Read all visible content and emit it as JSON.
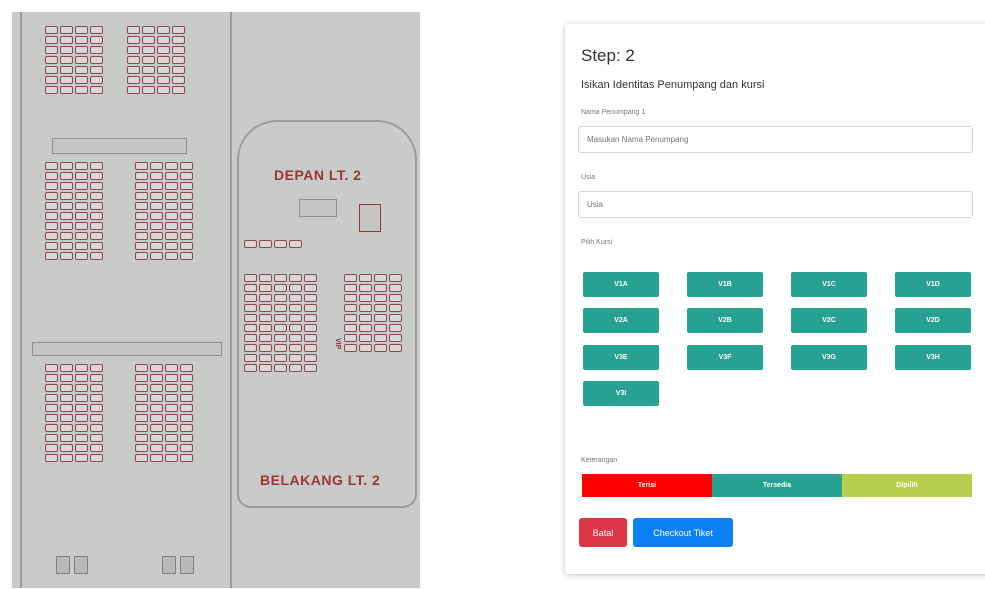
{
  "seatmap": {
    "upper_front_label": "DEPAN LT. 2",
    "upper_back_label": "BELAKANG LT. 2",
    "vip_label": "VIP"
  },
  "form": {
    "step_title": "Step: 2",
    "subtitle": "Isikan Identitas Penumpang dan kursi",
    "passenger_label": "Nama Penumpang 1",
    "passenger_placeholder": "Masukan Nama Penumpang",
    "age_label": "Usia",
    "age_placeholder": "Usia",
    "seat_label": "Pilih Kursi",
    "seats": [
      "V1A",
      "V1B",
      "V1C",
      "V1D",
      "V2A",
      "V2B",
      "V2C",
      "V2D",
      "V3E",
      "V3F",
      "V3G",
      "V3H",
      "V3I"
    ],
    "legend_label": "Keterangan",
    "legend": [
      {
        "label": "Terisi",
        "color": "#ff0000"
      },
      {
        "label": "Tersedia",
        "color": "#27a291"
      },
      {
        "label": "Dipilih",
        "color": "#b7cf4e"
      }
    ],
    "back_button": "Batal",
    "checkout_button": "Checkout Tiket"
  }
}
